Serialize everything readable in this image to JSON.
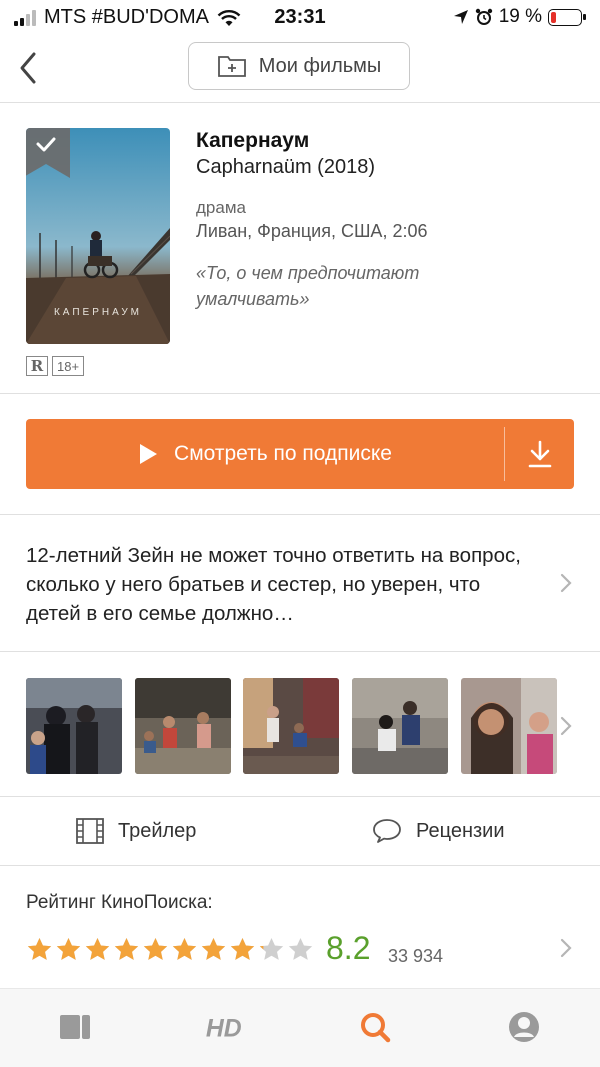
{
  "status_bar": {
    "carrier": "MTS #BUD'DOMA",
    "time": "23:31",
    "battery": "19 %",
    "battery_level": 0.19
  },
  "nav": {
    "my_films_label": "Мои фильмы"
  },
  "movie": {
    "title": "Капернаум",
    "original_title": "Capharnaüm (2018)",
    "genre": "драма",
    "countries_duration": "Ливан, Франция, США, 2:06",
    "tagline": "«То, о чем предпочитают умалчивать»",
    "poster_title": "КАПЕРНАУМ",
    "mpaa": "R",
    "age_rating": "18+"
  },
  "watch": {
    "label": "Смотреть по подписке",
    "accent_color": "#f07a36"
  },
  "synopsis": "12-летний Зейн не может точно ответить на вопрос, сколько у него братьев и сестер, но уверен, что детей в его семье должно…",
  "links": {
    "trailer": "Трейлер",
    "reviews": "Рецензии"
  },
  "rating": {
    "label": "Рейтинг КиноПоиска:",
    "value": "8.2",
    "votes": "33 934",
    "stars_filled": 8.2,
    "stars_total": 10,
    "star_color": "#f3a33a",
    "value_color": "#5aa02c"
  },
  "tabbar": {
    "active": "search-tab",
    "active_color": "#f07a36"
  }
}
